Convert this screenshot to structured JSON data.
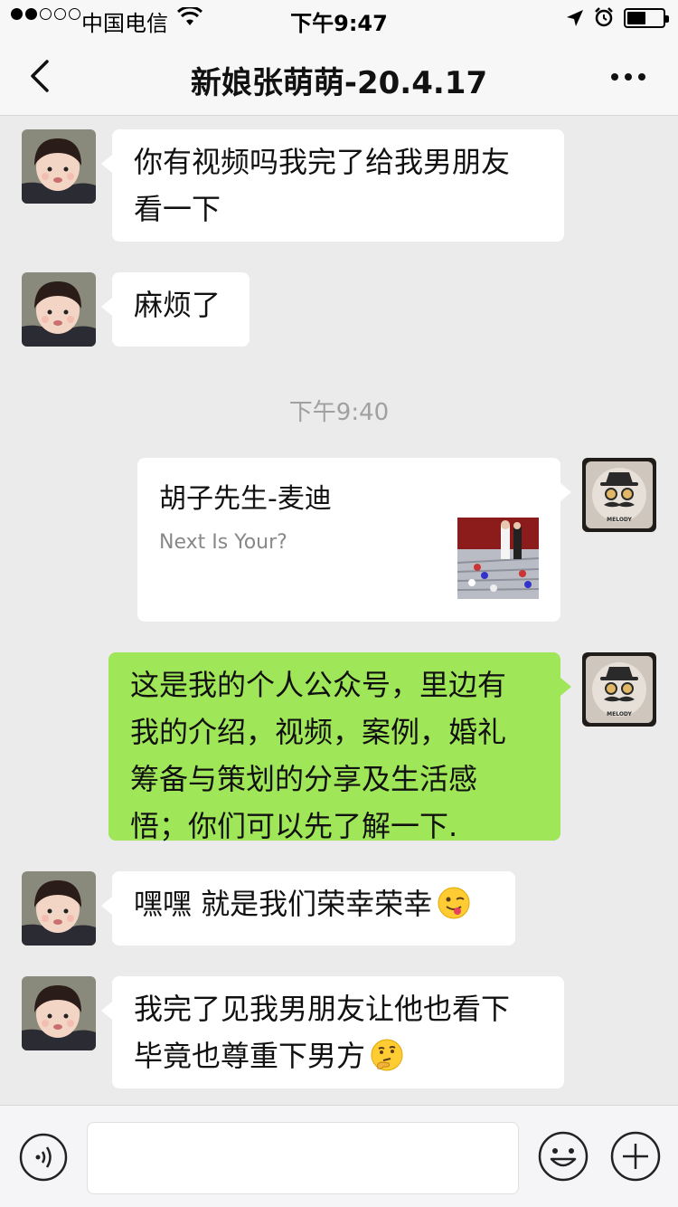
{
  "status_bar": {
    "carrier": "中国电信",
    "time": "下午9:47"
  },
  "nav": {
    "title": "新娘张萌萌-20.4.17"
  },
  "messages": [
    {
      "side": "left",
      "text_lines": [
        "你有视频吗我完了给我男朋友",
        "看一下"
      ]
    },
    {
      "side": "left",
      "text_lines": [
        "麻烦了"
      ]
    },
    {
      "timestamp": "下午9:40"
    },
    {
      "side": "right",
      "type": "card",
      "title": "胡子先生-麦迪",
      "desc": "Next Is Your?",
      "avatar_logo": "MELODY"
    },
    {
      "side": "right",
      "text_lines": [
        "这是我的个人公众号，里边有",
        "我的介绍，视频，案例，婚礼",
        "筹备与策划的分享及生活感",
        "悟；你们可以先了解一下."
      ]
    },
    {
      "side": "left",
      "text_lines": [
        "嘿嘿 就是我们荣幸荣幸"
      ],
      "emoji": "wink-tongue-emoji"
    },
    {
      "side": "left",
      "text_lines": [
        "我完了见我男朋友让他也看下",
        "毕竟也尊重下男方"
      ],
      "emoji": "thinking-emoji"
    }
  ],
  "input": {
    "value": "",
    "placeholder": ""
  },
  "colors": {
    "background": "#ebebeb",
    "bubble_self": "#9fe658",
    "bubble_other": "#ffffff",
    "bar": "#f7f7f7"
  }
}
